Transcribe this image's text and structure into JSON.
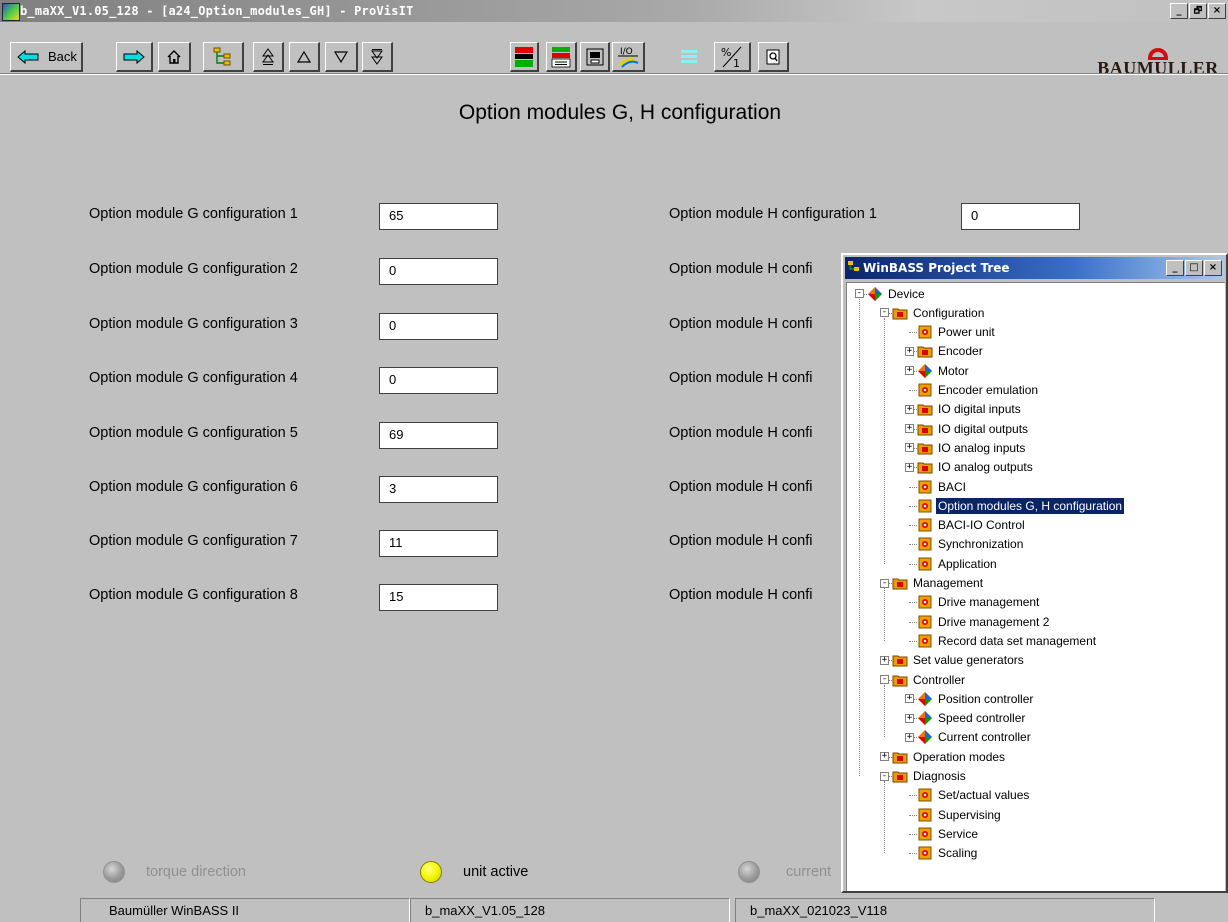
{
  "window": {
    "title": "b_maXX_V1.05_128 - [a24_Option_modules_GH] - ProVisIT",
    "controls": [
      "_",
      "β",
      "×"
    ]
  },
  "toolbar": {
    "back_label": "Back",
    "brand": "BAUMULLER"
  },
  "page": {
    "title": "Option modules G, H configuration"
  },
  "module_g": {
    "fields": [
      {
        "label": "Option module G configuration 1",
        "value": "65"
      },
      {
        "label": "Option module G configuration 2",
        "value": "0"
      },
      {
        "label": "Option module G configuration 3",
        "value": "0"
      },
      {
        "label": "Option module G configuration 4",
        "value": "0"
      },
      {
        "label": "Option module G configuration 5",
        "value": "69"
      },
      {
        "label": "Option module G configuration 6",
        "value": "3"
      },
      {
        "label": "Option module G configuration 7",
        "value": "11"
      },
      {
        "label": "Option module G configuration 8",
        "value": "15"
      }
    ]
  },
  "module_h": {
    "fields": [
      {
        "label": "Option module H configuration 1",
        "value": "0"
      },
      {
        "label": "Option module H confi"
      },
      {
        "label": "Option module H confi"
      },
      {
        "label": "Option module H confi"
      },
      {
        "label": "Option module H confi"
      },
      {
        "label": "Option module H confi"
      },
      {
        "label": "Option module H confi"
      },
      {
        "label": "Option module H confi"
      }
    ]
  },
  "indicators": [
    {
      "label": "torque direction",
      "state": "off"
    },
    {
      "label": "unit active",
      "state": "on"
    },
    {
      "label": "current",
      "state": "off"
    }
  ],
  "statusbar": {
    "app": "Baumüller WinBASS II",
    "project": "b_maXX_V1.05_128",
    "device": "b_maXX_021023_V118"
  },
  "tree": {
    "title": "WinBASS Project Tree",
    "nodes": [
      {
        "label": "Device",
        "icon": "device-icon"
      },
      {
        "label": "Configuration",
        "icon": "folder-icon"
      },
      {
        "label": "Power unit",
        "icon": "parameter-page-icon"
      },
      {
        "label": "Encoder",
        "icon": "folder-icon"
      },
      {
        "label": "Motor",
        "icon": "device-icon"
      },
      {
        "label": "Encoder emulation",
        "icon": "parameter-page-icon"
      },
      {
        "label": "IO digital inputs",
        "icon": "folder-icon"
      },
      {
        "label": "IO digital outputs",
        "icon": "folder-icon"
      },
      {
        "label": "IO analog inputs",
        "icon": "folder-icon"
      },
      {
        "label": "IO analog outputs",
        "icon": "folder-icon"
      },
      {
        "label": "BACI",
        "icon": "parameter-page-icon"
      },
      {
        "label": "Option modules G, H configuration",
        "icon": "parameter-page-icon",
        "selected": true
      },
      {
        "label": "BACI-IO Control",
        "icon": "parameter-page-icon"
      },
      {
        "label": "Synchronization",
        "icon": "parameter-page-icon"
      },
      {
        "label": "Application",
        "icon": "parameter-page-icon"
      },
      {
        "label": "Management",
        "icon": "folder-icon"
      },
      {
        "label": "Drive management",
        "icon": "parameter-page-icon"
      },
      {
        "label": "Drive management 2",
        "icon": "parameter-page-icon"
      },
      {
        "label": "Record data set management",
        "icon": "parameter-page-icon"
      },
      {
        "label": "Set value generators",
        "icon": "folder-icon"
      },
      {
        "label": "Controller",
        "icon": "folder-icon"
      },
      {
        "label": "Position controller",
        "icon": "device-icon"
      },
      {
        "label": "Speed controller",
        "icon": "device-icon"
      },
      {
        "label": "Current controller",
        "icon": "device-icon"
      },
      {
        "label": "Operation modes",
        "icon": "folder-icon"
      },
      {
        "label": "Diagnosis",
        "icon": "folder-icon"
      },
      {
        "label": "Set/actual values",
        "icon": "parameter-page-icon"
      },
      {
        "label": "Supervising",
        "icon": "parameter-page-icon"
      },
      {
        "label": "Service",
        "icon": "parameter-page-icon"
      },
      {
        "label": "Scaling",
        "icon": "parameter-page-icon"
      }
    ]
  },
  "colors": {
    "selection": "#0a246a",
    "led_on": "#f6f600",
    "led_off": "#9a9a9a",
    "window_bg": "#c0c0c0"
  }
}
